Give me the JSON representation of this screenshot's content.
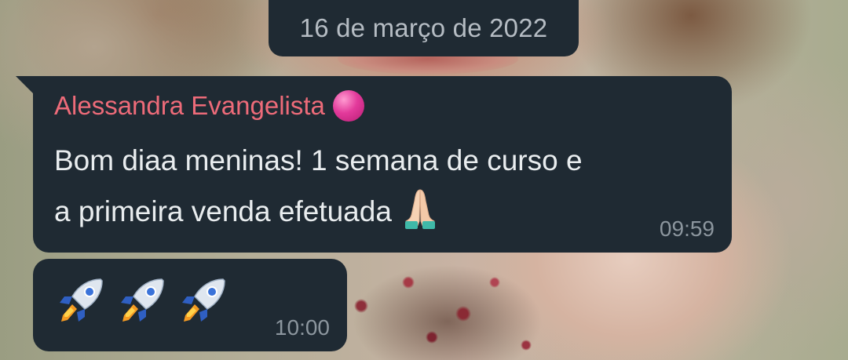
{
  "date_separator": "16 de março de 2022",
  "messages": [
    {
      "sender": "Alessandra Evangelista",
      "sender_color": "#ed6b79",
      "sender_badge_icon": "pink-circle-emoji",
      "text_line1": "Bom diaa meninas! 1 semana de curso e",
      "text_line2": "a primeira venda efetuada",
      "trailing_icon": "folded-hands-emoji",
      "time": "09:59"
    },
    {
      "icons": [
        "rocket-emoji",
        "rocket-emoji",
        "rocket-emoji"
      ],
      "time": "10:00"
    }
  ],
  "colors": {
    "bubble": "#1f2a33",
    "text": "#e9edef",
    "timestamp": "#8c969e",
    "date_chip_text": "#b5bcc3"
  }
}
